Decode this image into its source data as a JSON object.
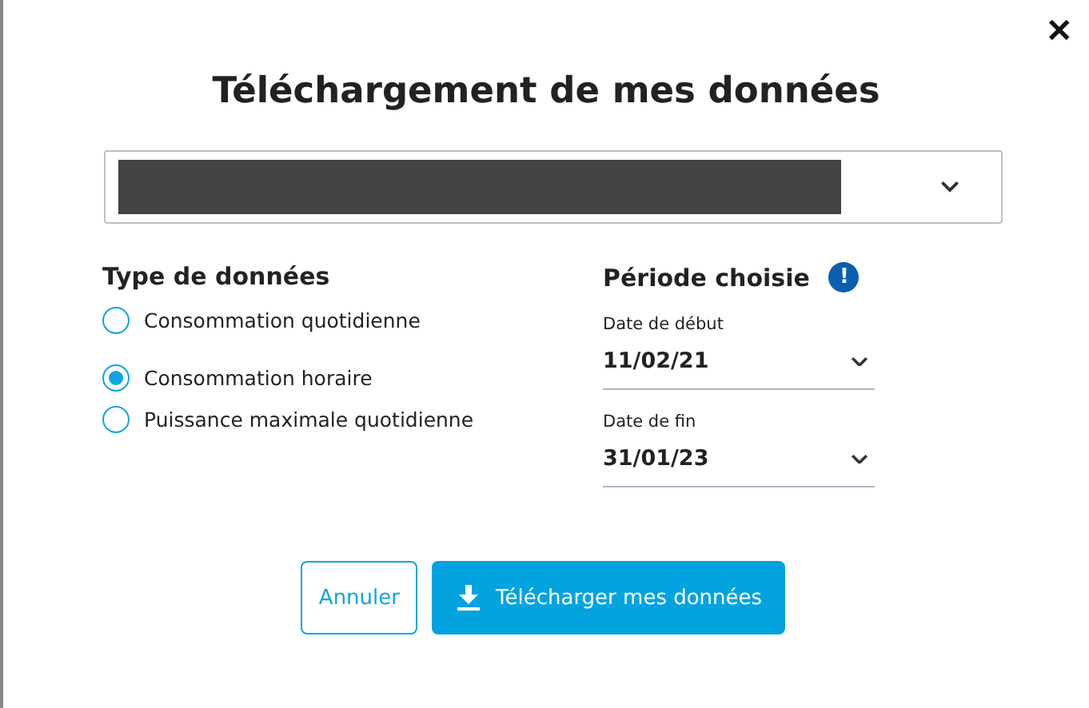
{
  "dialog": {
    "title": "Téléchargement de mes données",
    "close": "✕"
  },
  "select": {
    "redacted": true
  },
  "data_type": {
    "heading": "Type de données",
    "options": [
      {
        "label": "Consommation quotidienne",
        "selected": false
      },
      {
        "label": "Consommation horaire",
        "selected": true
      },
      {
        "label": "Puissance maximale quotidienne",
        "selected": false
      }
    ]
  },
  "period": {
    "heading": "Période choisie",
    "info": "!",
    "fields": [
      {
        "label": "Date de début",
        "value": "11/02/21"
      },
      {
        "label": "Date de fin",
        "value": "31/01/23"
      }
    ]
  },
  "buttons": {
    "cancel": "Annuler",
    "download": "Télécharger mes données"
  }
}
